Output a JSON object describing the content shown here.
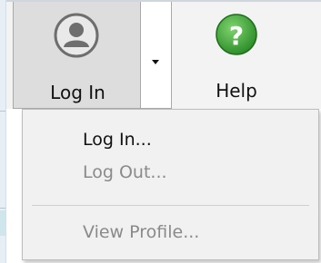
{
  "toolbar": {
    "login_label": "Log In",
    "help_label": "Help",
    "login_icon": "user-avatar-icon",
    "help_icon": "help-circle-icon",
    "dropdown_icon": "chevron-down-icon"
  },
  "menu": {
    "items": [
      {
        "label": "Log In...",
        "enabled": true
      },
      {
        "label": "Log Out...",
        "enabled": false
      },
      {
        "label": "View Profile...",
        "enabled": false
      }
    ]
  },
  "colors": {
    "help_green": "#3aa535",
    "avatar_gray": "#6e6e6e",
    "menu_bg": "#f1f1f1",
    "disabled_text": "#8a8a8a"
  }
}
